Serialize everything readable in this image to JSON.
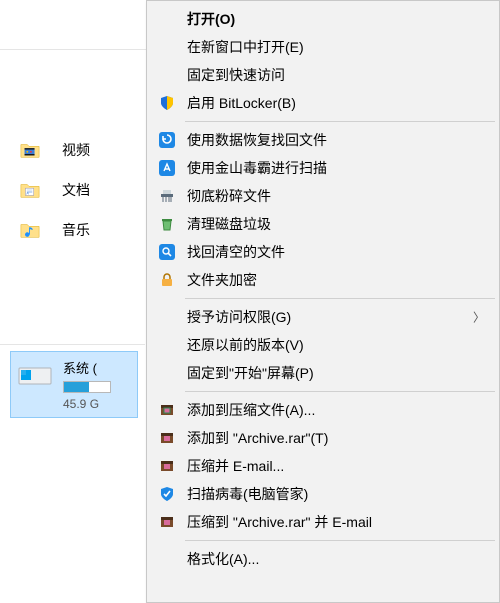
{
  "libraries": {
    "videos": "视频",
    "documents": "文档",
    "music": "音乐"
  },
  "drive": {
    "name": "系统 (",
    "size": "45.9 G"
  },
  "menu": {
    "open": "打开(O)",
    "open_new_window": "在新窗口中打开(E)",
    "pin_quick_access": "固定到快速访问",
    "bitlocker": "启用 BitLocker(B)",
    "data_recovery": "使用数据恢复找回文件",
    "jinshan_scan": "使用金山毒霸进行扫描",
    "shred": "彻底粉碎文件",
    "clean_disk": "清理磁盘垃圾",
    "find_emptied": "找回清空的文件",
    "folder_encrypt": "文件夹加密",
    "grant_access": "授予访问权限(G)",
    "restore_previous": "还原以前的版本(V)",
    "pin_start": "固定到\"开始\"屏幕(P)",
    "add_archive": "添加到压缩文件(A)...",
    "add_archive_rar": "添加到 \"Archive.rar\"(T)",
    "compress_email": "压缩并 E-mail...",
    "scan_virus": "扫描病毒(电脑管家)",
    "compress_rar_email": "压缩到 \"Archive.rar\" 并 E-mail",
    "format": "格式化(A)..."
  }
}
